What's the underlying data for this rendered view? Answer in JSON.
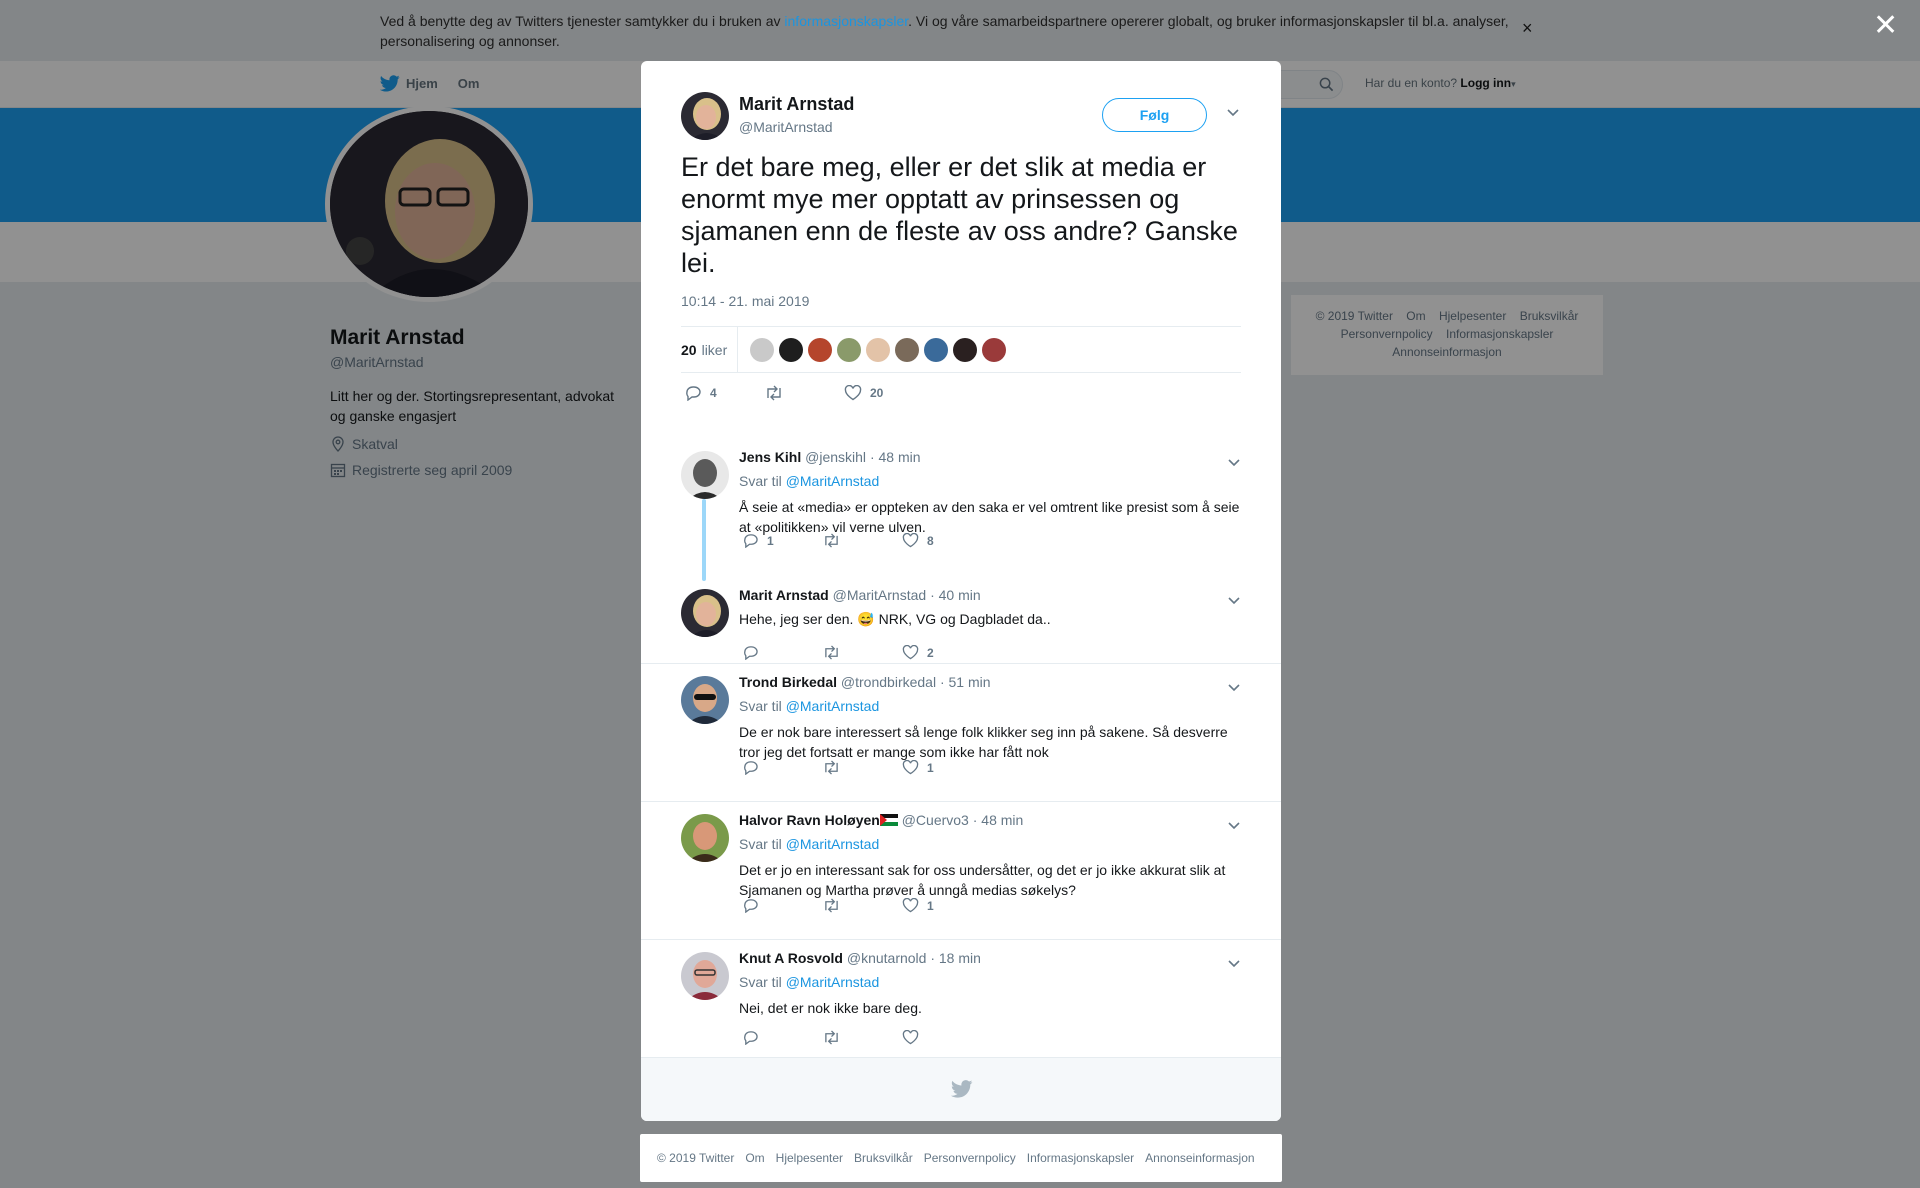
{
  "cookie_banner": {
    "text_before": "Ved å benytte deg av Twitters tjenester samtykker du i bruken av ",
    "link_text": "informasjonskapsler",
    "text_after": ". Vi og våre samarbeidspartnere opererer globalt, og bruker informasjonskapsler til bl.a. analyser, personalisering og annonser.",
    "close_label": "×"
  },
  "overlay_close_label": "✕",
  "background": {
    "nav": {
      "home_label": "Hjem",
      "about_label": "Om"
    },
    "login": {
      "prompt": "Har du en konto?",
      "link": "Logg inn"
    },
    "profile": {
      "name": "Marit Arnstad",
      "handle": "@MaritArnstad",
      "bio": "Litt her og der. Stortingsrepresentant, advokat og ganske engasjert",
      "location": "Skatval",
      "joined": "Registrerte seg april 2009"
    },
    "footer_links": [
      "© 2019 Twitter",
      "Om",
      "Hjelpesenter",
      "Bruksvilkår",
      "Personvernpolicy",
      "Informasjonskapsler",
      "Annonseinformasjon"
    ]
  },
  "tweet": {
    "author_name": "Marit Arnstad",
    "author_handle": "@MaritArnstad",
    "follow_label": "Følg",
    "text": "Er det bare meg, eller er det slik at media er enormt mye mer opptatt av prinsessen og sjamanen enn de fleste av oss andre? Ganske lei.",
    "time": "10:14 - 21. mai 2019",
    "likes_count": "20",
    "likes_label": "liker",
    "likers": [
      "#c9c9c9",
      "#1e1e1e",
      "#b5452c",
      "#8a9a6a",
      "#e3c3a8",
      "#7a6a5a",
      "#3a6a9a",
      "#2a2020",
      "#9a3a3a"
    ],
    "actions": {
      "replies": "4",
      "retweets": "",
      "likes": "20"
    }
  },
  "replies": [
    {
      "name": "Jens Kihl",
      "handle": "@jenskihl",
      "time": "· 48 min",
      "reply_to_label": "Svar til",
      "reply_to": "@MaritArnstad",
      "text": "Å seie at «media» er oppteken av den saka er vel omtrent like presist som å seie at «politikken» vil verne ulven.",
      "replies": "1",
      "retweets": "",
      "likes": "8",
      "avatar_color": "#3a3a3a"
    },
    {
      "name": "Marit Arnstad",
      "handle": "@MaritArnstad",
      "time": "· 40 min",
      "text_before": "Hehe, jeg ser den. ",
      "emoji": "😅",
      "text_after": " NRK, VG og Dagbladet da..",
      "replies": "",
      "retweets": "",
      "likes": "2"
    },
    {
      "name": "Trond Birkedal",
      "handle": "@trondbirkedal",
      "time": "· 51 min",
      "reply_to_label": "Svar til",
      "reply_to": "@MaritArnstad",
      "text": "De er nok bare interessert så lenge folk klikker seg inn på sakene. Så desverre tror jeg det fortsatt er mange som ikke har fått nok",
      "replies": "",
      "retweets": "",
      "likes": "1",
      "avatar_color": "#1f3a5a"
    },
    {
      "name": "Halvor Ravn Holøyen",
      "handle": "@Cuervo3",
      "time": "· 48 min",
      "reply_to_label": "Svar til",
      "reply_to": "@MaritArnstad",
      "text": "Det er jo en interessant sak for oss undersåtter, og det er jo ikke akkurat slik at Sjamanen og Martha prøver å unngå medias søkelys?",
      "replies": "",
      "retweets": "",
      "likes": "1",
      "avatar_color": "#7a8a3a"
    },
    {
      "name": "Knut A Rosvold",
      "handle": "@knutarnold",
      "time": "· 18 min",
      "reply_to_label": "Svar til",
      "reply_to": "@MaritArnstad",
      "text": "Nei, det er nok ikke bare deg.",
      "replies": "",
      "retweets": "",
      "likes": "",
      "avatar_color": "#9a4a4a"
    }
  ],
  "footer_links": [
    "© 2019 Twitter",
    "Om",
    "Hjelpesenter",
    "Bruksvilkår",
    "Personvernpolicy",
    "Informasjonskapsler",
    "Annonseinformasjon"
  ],
  "colors": {
    "accent": "#1da1f2",
    "link": "#1b95e0",
    "muted": "#657786",
    "overlay": "rgba(0,0,0,0.43)"
  }
}
